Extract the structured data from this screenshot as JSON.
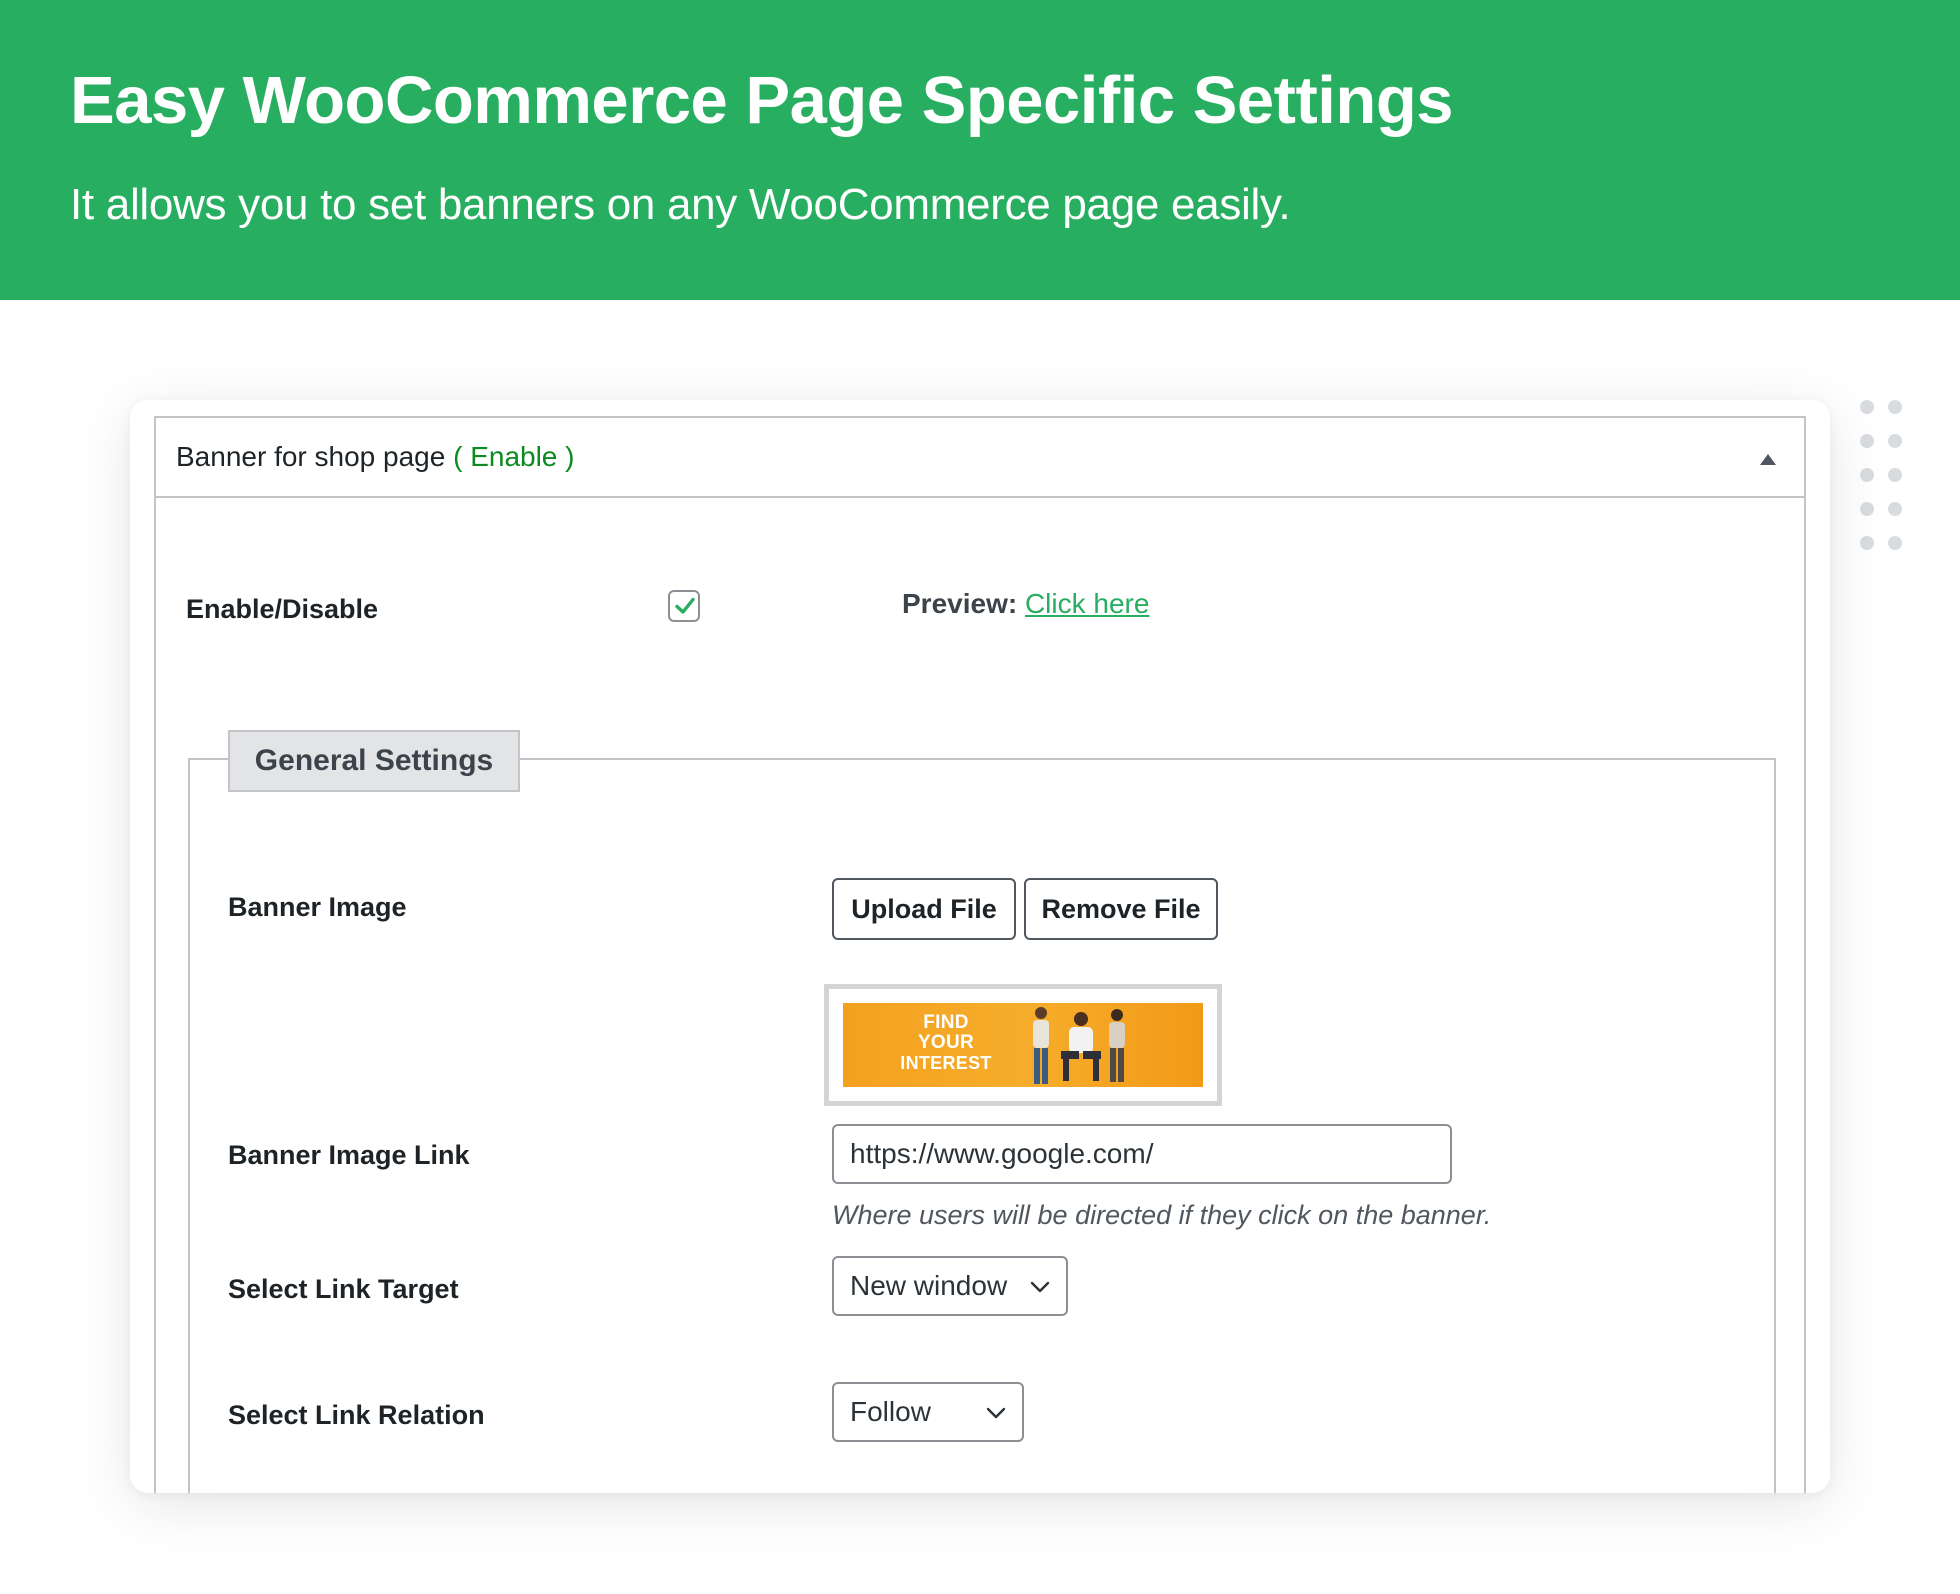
{
  "hero": {
    "title": "Easy WooCommerce Page Specific Settings",
    "subtitle": "It allows you to set banners on any WooCommerce page easily."
  },
  "panel": {
    "title": "Banner for shop page",
    "status": "( Enable )",
    "enable_label": "Enable/Disable",
    "enable_checked": true,
    "preview_label": "Preview:",
    "preview_link": "Click here"
  },
  "general_settings": {
    "legend": "General Settings",
    "banner_image_label": "Banner Image",
    "upload_button": "Upload File",
    "remove_button": "Remove File",
    "banner_preview": {
      "line1": "FIND",
      "line2": "YOUR",
      "line3": "INTEREST"
    },
    "banner_link_label": "Banner Image Link",
    "banner_link_value": "https://www.google.com/",
    "banner_link_help": "Where users will be directed if they click on the banner.",
    "link_target_label": "Select Link Target",
    "link_target_value": "New window",
    "link_relation_label": "Select Link Relation",
    "link_relation_value": "Follow"
  },
  "colors": {
    "brand_green": "#28ae60",
    "status_green": "#0a8a1f",
    "banner_orange": "#f3a01f"
  }
}
